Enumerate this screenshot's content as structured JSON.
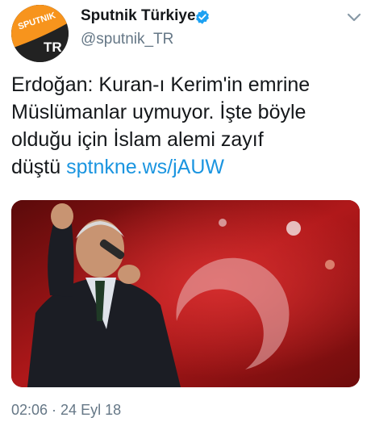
{
  "account": {
    "display_name": "Sputnik Türkiye",
    "handle": "@sputnik_TR",
    "verified": true,
    "avatar_logo_text": "SPUTNIK",
    "avatar_corner_text": "TR"
  },
  "tweet": {
    "text_lines": [
      "Erdoğan: Kuran-ı Kerim'in emrine",
      "Müslümanlar uymuyor. İşte böyle",
      "olduğu için İslam alemi zayıf"
    ],
    "last_line_prefix": "düştü",
    "link_text": "sptnkne.ws/jAUW"
  },
  "meta": {
    "timestamp": "02:06 · 24 Eyl 18"
  },
  "icons": {
    "verified": "verified-badge-icon",
    "menu": "chevron-down-icon"
  },
  "colors": {
    "link": "#1b95e0",
    "verified": "#1da1f2",
    "muted": "#657786",
    "avatar_orange": "#f7941d"
  }
}
